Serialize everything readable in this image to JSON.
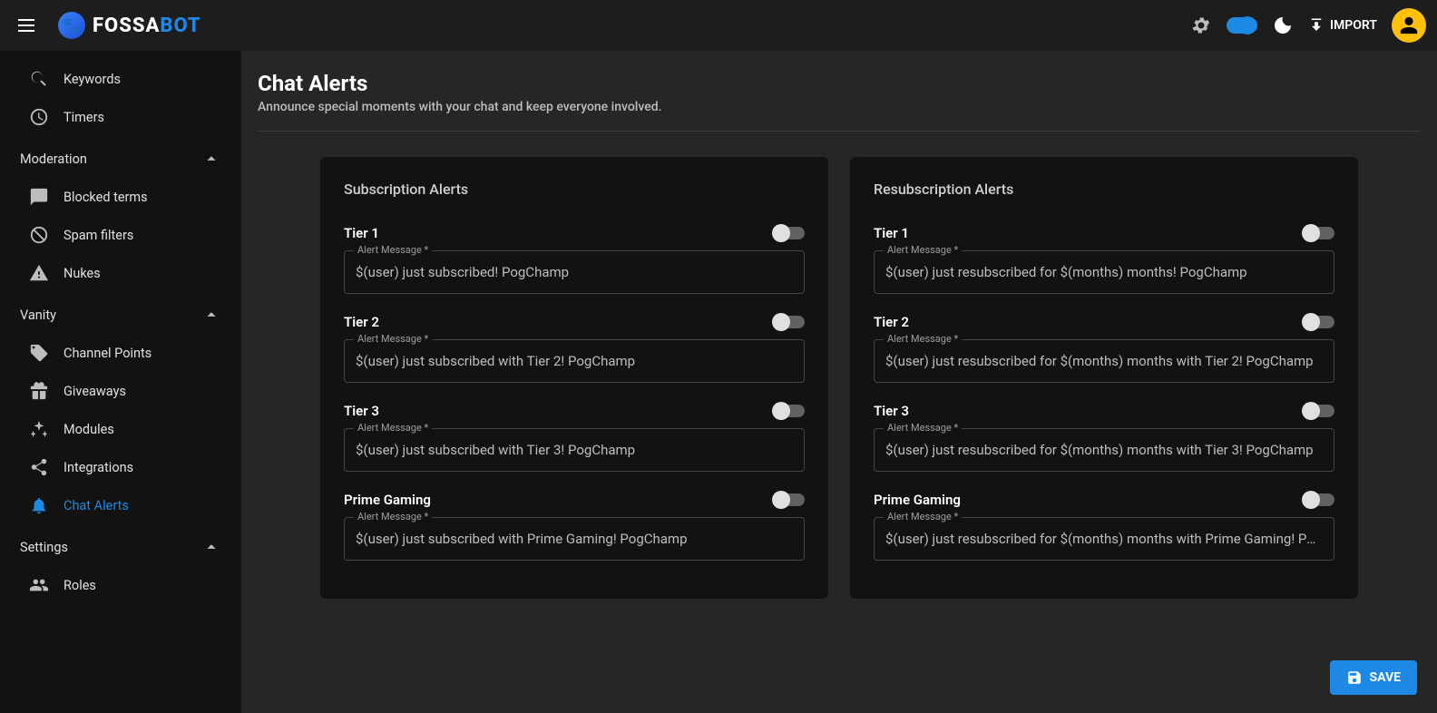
{
  "header": {
    "brand_1": "FOSSA",
    "brand_2": "BOT",
    "import_label": "IMPORT"
  },
  "sidebar": {
    "keywords": "Keywords",
    "timers": "Timers",
    "section_moderation": "Moderation",
    "blocked_terms": "Blocked terms",
    "spam_filters": "Spam filters",
    "nukes": "Nukes",
    "section_vanity": "Vanity",
    "channel_points": "Channel Points",
    "giveaways": "Giveaways",
    "modules": "Modules",
    "integrations": "Integrations",
    "chat_alerts": "Chat Alerts",
    "section_settings": "Settings",
    "roles": "Roles"
  },
  "page": {
    "title": "Chat Alerts",
    "subtitle": "Announce special moments with your chat and keep everyone involved."
  },
  "subCard": {
    "title": "Subscription Alerts",
    "tier1_label": "Tier 1",
    "tier1_msg": "$(user) just subscribed! PogChamp",
    "tier2_label": "Tier 2",
    "tier2_msg": "$(user) just subscribed with Tier 2! PogChamp",
    "tier3_label": "Tier 3",
    "tier3_msg": "$(user) just subscribed with Tier 3! PogChamp",
    "prime_label": "Prime Gaming",
    "prime_msg": "$(user) just subscribed with Prime Gaming! PogChamp"
  },
  "resubCard": {
    "title": "Resubscription Alerts",
    "tier1_label": "Tier 1",
    "tier1_msg": "$(user) just resubscribed for $(months) months! PogChamp",
    "tier2_label": "Tier 2",
    "tier2_msg": "$(user) just resubscribed for $(months) months with Tier 2! PogChamp",
    "tier3_label": "Tier 3",
    "tier3_msg": "$(user) just resubscribed for $(months) months with Tier 3! PogChamp",
    "prime_label": "Prime Gaming",
    "prime_msg": "$(user) just resubscribed for $(months) months with Prime Gaming! PogChamp"
  },
  "field_label_text": "Alert Message *",
  "save_label": "SAVE"
}
